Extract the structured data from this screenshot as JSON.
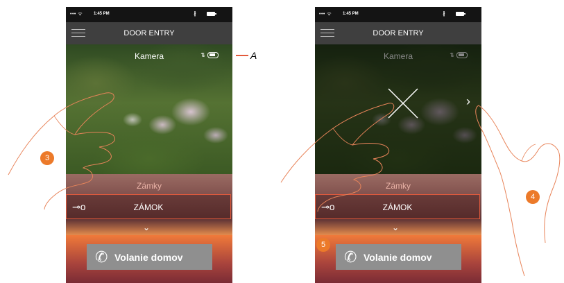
{
  "status_bar": {
    "signal": "••• ",
    "time": "1:45 PM"
  },
  "app": {
    "title": "DOOR ENTRY"
  },
  "camera": {
    "label": "Kamera"
  },
  "locks": {
    "header": "Zámky",
    "item_label": "ZÁMOK"
  },
  "call": {
    "label": "Volanie domov"
  },
  "annotations": {
    "callout": "A",
    "step3": "3",
    "step4": "4",
    "step5": "5"
  },
  "colors": {
    "accent": "#ec7a2a",
    "title_bar": "#3f3f3f",
    "call_button": "#8f8f8f"
  }
}
